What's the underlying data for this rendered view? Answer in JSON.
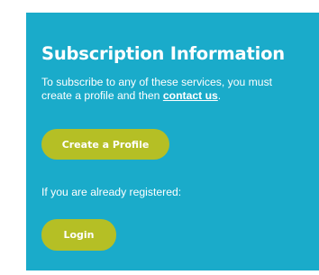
{
  "panel": {
    "background_color": "#1aabca",
    "title": "Subscription Information",
    "description_before": "To subscribe to any of these services, you must create a profile and then ",
    "contact_link": "contact us",
    "description_after": ".",
    "create_button": "Create a Profile",
    "registered_text": "If you are already registered:",
    "login_button": "Login",
    "button_color": "#b5bf25"
  }
}
